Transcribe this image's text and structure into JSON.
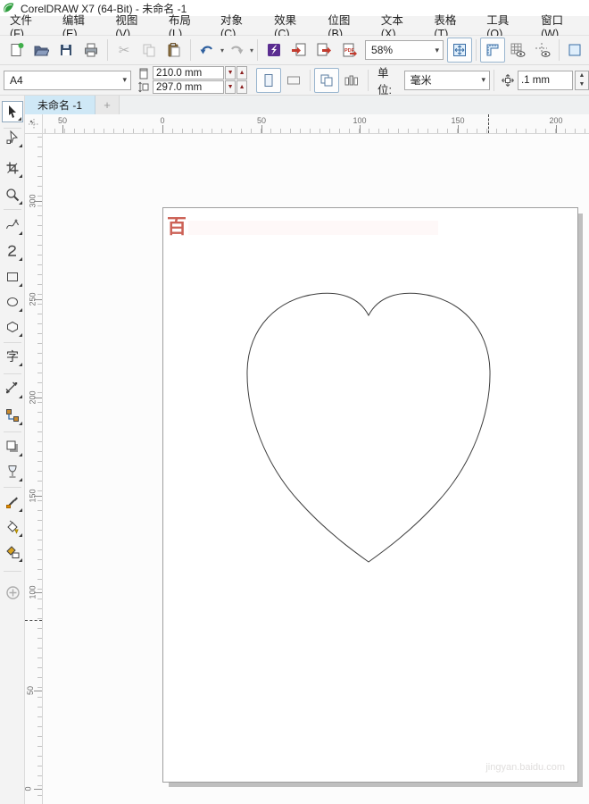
{
  "window": {
    "title": "CorelDRAW X7 (64-Bit) - 未命名 -1"
  },
  "menu": {
    "items": [
      "文件(F)",
      "编辑(E)",
      "视图(V)",
      "布局(L)",
      "对象(C)",
      "效果(C)",
      "位图(B)",
      "文本(X)",
      "表格(T)",
      "工具(O)",
      "窗口(W)"
    ]
  },
  "toolbar": {
    "zoom_level": "58%",
    "pdf_label": "PDF",
    "buttons": [
      "new-document",
      "open",
      "save",
      "print",
      "cut",
      "copy",
      "paste",
      "undo",
      "redo",
      "search-content",
      "import",
      "export",
      "publish-to-pdf",
      "zoom-levels",
      "fit-page",
      "show-rulers",
      "show-grid",
      "show-guidelines",
      "snap-to"
    ]
  },
  "property_bar": {
    "page_preset": "A4",
    "page_width": "210.0 mm",
    "page_height": "297.0 mm",
    "units_label": "单位:",
    "units_value": "毫米",
    "nudge_value": ".1 mm"
  },
  "document_tabs": {
    "active_tab": "未命名 -1",
    "new_tab_label": "+"
  },
  "rulers": {
    "horizontal_labels": [
      "50",
      "0",
      "50",
      "100",
      "150",
      "200"
    ],
    "vertical_labels": [
      "300",
      "250",
      "200",
      "150",
      "100",
      "50",
      "0"
    ]
  },
  "toolbox": {
    "text_tool_glyph": "字",
    "tools": [
      "pick",
      "shape",
      "crop",
      "zoom",
      "freehand",
      "artistic-media",
      "rectangle",
      "ellipse",
      "polygon",
      "text",
      "parallel-dimension",
      "connector",
      "drop-shadow",
      "transparency",
      "color-eyedropper",
      "interactive-fill",
      "smart-fill",
      "add-tools"
    ]
  },
  "page": {
    "watermark_top": "百",
    "watermark_bottom": "jingyan.baidu.com"
  },
  "colors": {
    "accent_blue": "#2e5f9e",
    "tab_active": "#cfe8f6",
    "watermark_red": "#c3463a",
    "search_purple": "#5b2d91",
    "new_green": "#3fae4a"
  }
}
